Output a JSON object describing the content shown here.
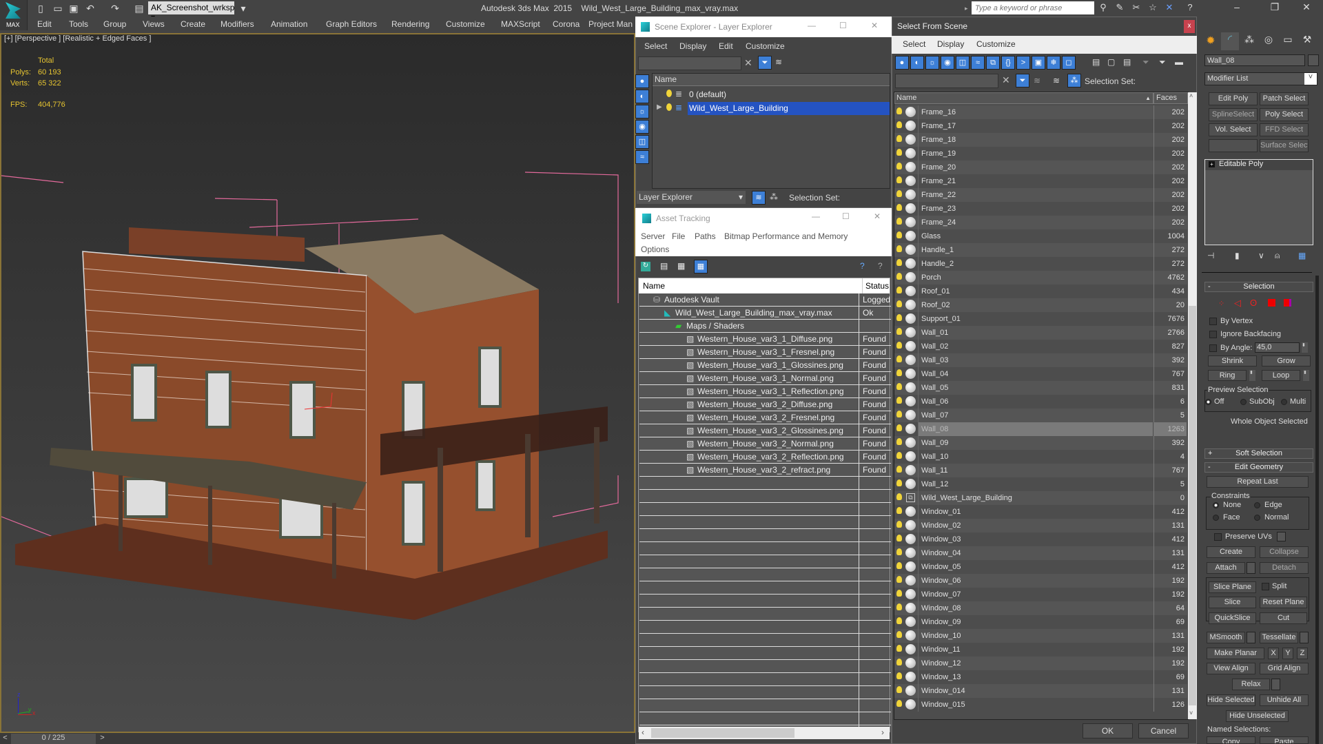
{
  "app": {
    "logo_label": "MAX",
    "workspace": "AK_Screenshot_wrksp",
    "title": "Autodesk 3ds Max  2015    Wild_West_Large_Building_max_vray.max",
    "search_placeholder": "Type a keyword or phrase"
  },
  "menubar": [
    "Edit",
    "Tools",
    "Group",
    "Views",
    "Create",
    "Modifiers",
    "Animation",
    "Graph Editors",
    "Rendering",
    "Customize",
    "MAXScript",
    "Corona",
    "Project Man"
  ],
  "viewport": {
    "label": "[+] [Perspective ] [Realistic + Edged Faces ]",
    "stats": {
      "header": "Total",
      "polys_label": "Polys:",
      "polys": "60 193",
      "verts_label": "Verts:",
      "verts": "65 322",
      "fps_label": "FPS:",
      "fps": "404,776"
    },
    "axis": {
      "z": "z",
      "y": "y",
      "x": "x"
    }
  },
  "timeline": {
    "prev": "<",
    "frame": "0 / 225",
    "next": ">"
  },
  "scene_explorer": {
    "title": "Scene Explorer - Layer Explorer",
    "menus": [
      "Select",
      "Display",
      "Edit",
      "Customize"
    ],
    "column_name": "Name",
    "layers": [
      {
        "name": "0 (default)",
        "selected": false
      },
      {
        "name": "Wild_West_Large_Building",
        "selected": true
      }
    ],
    "footer_dropdown": "Layer Explorer",
    "selection_set_label": "Selection Set:"
  },
  "asset_tracking": {
    "title": "Asset Tracking",
    "menus": [
      "Server",
      "File",
      "Paths",
      "Bitmap Performance and Memory",
      "Options"
    ],
    "columns": {
      "name": "Name",
      "status": "Status"
    },
    "rows": [
      {
        "name": "Autodesk Vault",
        "status": "Logged",
        "level": 0,
        "icon": "vault-icon"
      },
      {
        "name": "Wild_West_Large_Building_max_vray.max",
        "status": "Ok",
        "level": 1,
        "icon": "max-file-icon"
      },
      {
        "name": "Maps / Shaders",
        "status": "",
        "level": 2,
        "icon": "maps-icon"
      },
      {
        "name": "Western_House_var3_1_Diffuse.png",
        "status": "Found",
        "level": 3,
        "icon": "bitmap-icon"
      },
      {
        "name": "Western_House_var3_1_Fresnel.png",
        "status": "Found",
        "level": 3,
        "icon": "bitmap-icon"
      },
      {
        "name": "Western_House_var3_1_Glossines.png",
        "status": "Found",
        "level": 3,
        "icon": "bitmap-icon"
      },
      {
        "name": "Western_House_var3_1_Normal.png",
        "status": "Found",
        "level": 3,
        "icon": "bitmap-icon"
      },
      {
        "name": "Western_House_var3_1_Reflection.png",
        "status": "Found",
        "level": 3,
        "icon": "bitmap-icon"
      },
      {
        "name": "Western_House_var3_2_Diffuse.png",
        "status": "Found",
        "level": 3,
        "icon": "bitmap-icon"
      },
      {
        "name": "Western_House_var3_2_Fresnel.png",
        "status": "Found",
        "level": 3,
        "icon": "bitmap-icon"
      },
      {
        "name": "Western_House_var3_2_Glossines.png",
        "status": "Found",
        "level": 3,
        "icon": "bitmap-icon"
      },
      {
        "name": "Western_House_var3_2_Normal.png",
        "status": "Found",
        "level": 3,
        "icon": "bitmap-icon"
      },
      {
        "name": "Western_House_var3_2_Reflection.png",
        "status": "Found",
        "level": 3,
        "icon": "bitmap-icon"
      },
      {
        "name": "Western_House_var3_2_refract.png",
        "status": "Found",
        "level": 3,
        "icon": "bitmap-icon"
      }
    ]
  },
  "select_from_scene": {
    "title": "Select From Scene",
    "close": "x",
    "menus": [
      "Select",
      "Display",
      "Customize"
    ],
    "selection_set_label": "Selection Set:",
    "columns": {
      "name": "Name",
      "faces": "Faces"
    },
    "rows": [
      {
        "name": "Frame_16",
        "faces": "202"
      },
      {
        "name": "Frame_17",
        "faces": "202"
      },
      {
        "name": "Frame_18",
        "faces": "202"
      },
      {
        "name": "Frame_19",
        "faces": "202"
      },
      {
        "name": "Frame_20",
        "faces": "202"
      },
      {
        "name": "Frame_21",
        "faces": "202"
      },
      {
        "name": "Frame_22",
        "faces": "202"
      },
      {
        "name": "Frame_23",
        "faces": "202"
      },
      {
        "name": "Frame_24",
        "faces": "202"
      },
      {
        "name": "Glass",
        "faces": "1004"
      },
      {
        "name": "Handle_1",
        "faces": "272"
      },
      {
        "name": "Handle_2",
        "faces": "272"
      },
      {
        "name": "Porch",
        "faces": "4762"
      },
      {
        "name": "Roof_01",
        "faces": "434"
      },
      {
        "name": "Roof_02",
        "faces": "20"
      },
      {
        "name": "Support_01",
        "faces": "7676"
      },
      {
        "name": "Wall_01",
        "faces": "2766"
      },
      {
        "name": "Wall_02",
        "faces": "827"
      },
      {
        "name": "Wall_03",
        "faces": "392"
      },
      {
        "name": "Wall_04",
        "faces": "767"
      },
      {
        "name": "Wall_05",
        "faces": "831"
      },
      {
        "name": "Wall_06",
        "faces": "6"
      },
      {
        "name": "Wall_07",
        "faces": "5"
      },
      {
        "name": "Wall_08",
        "faces": "1263",
        "selected": true
      },
      {
        "name": "Wall_09",
        "faces": "392"
      },
      {
        "name": "Wall_10",
        "faces": "4"
      },
      {
        "name": "Wall_11",
        "faces": "767"
      },
      {
        "name": "Wall_12",
        "faces": "5"
      },
      {
        "name": "Wild_West_Large_Building",
        "faces": "0",
        "group": true
      },
      {
        "name": "Window_01",
        "faces": "412"
      },
      {
        "name": "Window_02",
        "faces": "131"
      },
      {
        "name": "Window_03",
        "faces": "412"
      },
      {
        "name": "Window_04",
        "faces": "131"
      },
      {
        "name": "Window_05",
        "faces": "412"
      },
      {
        "name": "Window_06",
        "faces": "192"
      },
      {
        "name": "Window_07",
        "faces": "192"
      },
      {
        "name": "Window_08",
        "faces": "64"
      },
      {
        "name": "Window_09",
        "faces": "69"
      },
      {
        "name": "Window_10",
        "faces": "131"
      },
      {
        "name": "Window_11",
        "faces": "192"
      },
      {
        "name": "Window_12",
        "faces": "192"
      },
      {
        "name": "Window_13",
        "faces": "69"
      },
      {
        "name": "Window_014",
        "faces": "131"
      },
      {
        "name": "Window_015",
        "faces": "126"
      }
    ],
    "ok": "OK",
    "cancel": "Cancel"
  },
  "command_panel": {
    "object_name": "Wall_08",
    "modifier_list": "Modifier List",
    "modifier_buttons": [
      "Edit Poly",
      "Patch Select",
      "SplineSelect",
      "Poly Select",
      "Vol. Select",
      "FFD Select",
      "",
      "Surface Select"
    ],
    "stack": [
      "Editable Poly"
    ],
    "selection": {
      "title": "Selection",
      "by_vertex": "By Vertex",
      "ignore_backfacing": "Ignore Backfacing",
      "by_angle": "By Angle:",
      "angle_value": "45,0",
      "shrink": "Shrink",
      "grow": "Grow",
      "ring": "Ring",
      "loop": "Loop",
      "preview_selection": "Preview Selection",
      "preview_off": "Off",
      "preview_subobj": "SubObj",
      "preview_multi": "Multi",
      "status": "Whole Object Selected"
    },
    "soft_selection": "Soft Selection",
    "edit_geometry": {
      "title": "Edit Geometry",
      "repeat_last": "Repeat Last",
      "constraints": "Constraints",
      "none": "None",
      "edge": "Edge",
      "face": "Face",
      "normal": "Normal",
      "preserve_uvs": "Preserve UVs",
      "create": "Create",
      "collapse": "Collapse",
      "attach": "Attach",
      "detach": "Detach",
      "slice_plane": "Slice Plane",
      "split": "Split",
      "slice": "Slice",
      "reset_plane": "Reset Plane",
      "quickslice": "QuickSlice",
      "cut": "Cut",
      "msmooth": "MSmooth",
      "tessellate": "Tessellate",
      "make_planar": "Make Planar",
      "x": "X",
      "y": "Y",
      "z": "Z",
      "view_align": "View Align",
      "grid_align": "Grid Align",
      "relax": "Relax",
      "hide_selected": "Hide Selected",
      "unhide_all": "Unhide All",
      "hide_unselected": "Hide Unselected",
      "named_selections": "Named Selections:",
      "copy": "Copy",
      "paste": "Paste"
    }
  }
}
